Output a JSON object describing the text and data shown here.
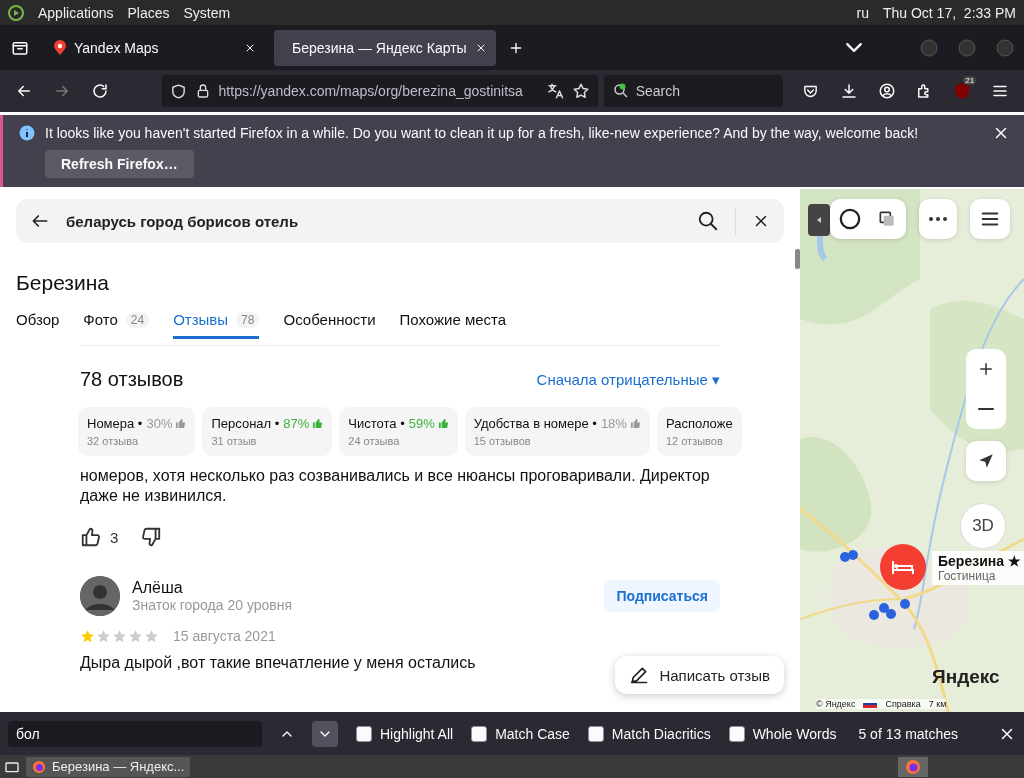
{
  "top_bar": {
    "menus": [
      "Applications",
      "Places",
      "System"
    ],
    "keyboard": "ru",
    "clock": "Thu Oct 17,  2:33 PM"
  },
  "browser": {
    "tabs": [
      {
        "title": "Yandex Maps",
        "selected": false
      },
      {
        "title": "Березина — Яндекс Карты",
        "selected": true
      }
    ],
    "url": "https://yandex.com/maps/org/berezina_gostinitsa",
    "search": {
      "placeholder": "Search"
    },
    "extension_badge": "21"
  },
  "notification": {
    "message": "It looks like you haven't started Firefox in a while. Do you want to clean it up for a fresh, like-new experience? And by the way, welcome back!",
    "button": "Refresh Firefox…"
  },
  "panel": {
    "query": "беларусь город борисов отель",
    "title": "Березина",
    "tabs": [
      {
        "label": "Обзор",
        "selected": false
      },
      {
        "label": "Фото",
        "count": "24",
        "selected": false
      },
      {
        "label": "Отзывы",
        "count": "78",
        "selected": true
      },
      {
        "label": "Особенности",
        "selected": false
      },
      {
        "label": "Похожие места",
        "selected": false
      }
    ],
    "reviews_heading": "78 отзывов",
    "sort": "Сначала отрицательные ▾",
    "categories": [
      {
        "name": "Номера •",
        "percent": "30%",
        "positive": false,
        "count": "32 отзыва"
      },
      {
        "name": "Персонал •",
        "percent": "87%",
        "positive": true,
        "count": "31 отзыв"
      },
      {
        "name": "Чистота •",
        "percent": "59%",
        "positive": true,
        "count": "24 отзыва"
      },
      {
        "name": "Удобства в номере •",
        "percent": "18%",
        "positive": false,
        "count": "15 отзывов"
      },
      {
        "name": "Расположе",
        "count": "12 отзывов"
      }
    ],
    "review_text": "номеров, хотя несколько раз созванивались и все нюансы проговаривали. Директор даже не извинился.",
    "likes": "3",
    "next_review": {
      "author": "Алёша",
      "level": "Знаток города 20 уровня",
      "subscribe": "Подписаться",
      "stars": 1,
      "date": "15 августа 2021",
      "text": "Дыра дырой ,вот такие впечатление у меня остались"
    },
    "write_review": "Написать отзыв"
  },
  "map": {
    "marker": {
      "name": "Березина ★",
      "category": "Гостиница"
    },
    "logo": "Яндекс",
    "copyright": "© Яндекс",
    "help": "Справка",
    "scale": "7 км",
    "compass": "3D"
  },
  "find_bar": {
    "value": "бол",
    "options": [
      {
        "label": "Highlight All",
        "checked": false
      },
      {
        "label": "Match Case",
        "checked": false
      },
      {
        "label": "Match Diacritics",
        "checked": false
      },
      {
        "label": "Whole Words",
        "checked": false
      }
    ],
    "status": "5 of 13 matches"
  },
  "taskbar": {
    "windows": [
      {
        "title": "Березина — Яндекс..."
      }
    ]
  }
}
